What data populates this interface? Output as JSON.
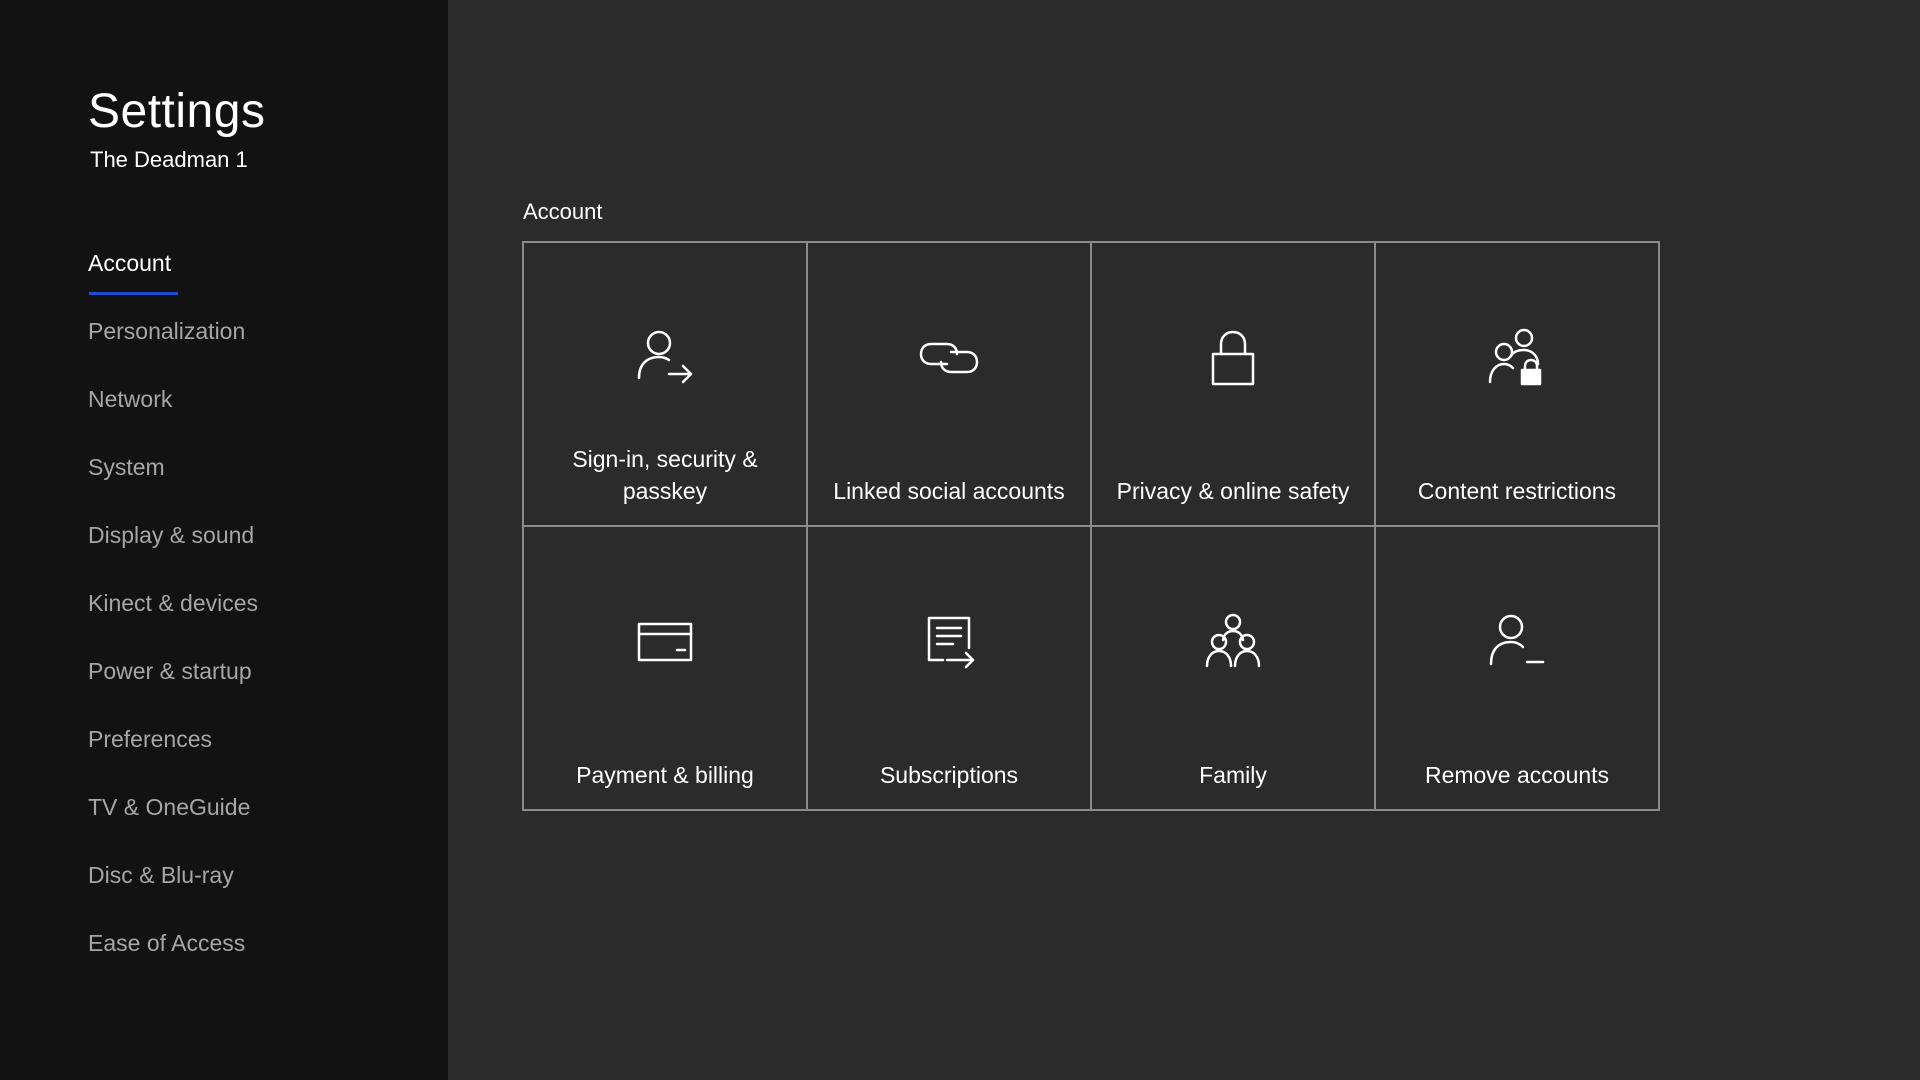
{
  "header": {
    "title": "Settings",
    "gamertag": "The Deadman 1"
  },
  "sidebar": {
    "items": [
      {
        "label": "Account",
        "active": true
      },
      {
        "label": "Personalization"
      },
      {
        "label": "Network"
      },
      {
        "label": "System"
      },
      {
        "label": "Display & sound"
      },
      {
        "label": "Kinect & devices"
      },
      {
        "label": "Power & startup"
      },
      {
        "label": "Preferences"
      },
      {
        "label": "TV & OneGuide"
      },
      {
        "label": "Disc & Blu-ray"
      },
      {
        "label": "Ease of Access"
      }
    ]
  },
  "main": {
    "section_title": "Account",
    "tiles": [
      {
        "label": "Sign-in, security & passkey",
        "icon": "person-arrow-icon"
      },
      {
        "label": "Linked social accounts",
        "icon": "link-icon"
      },
      {
        "label": "Privacy & online safety",
        "icon": "lock-icon"
      },
      {
        "label": "Content restrictions",
        "icon": "people-lock-icon"
      },
      {
        "label": "Payment & billing",
        "icon": "credit-card-icon"
      },
      {
        "label": "Subscriptions",
        "icon": "subscription-icon"
      },
      {
        "label": "Family",
        "icon": "family-icon"
      },
      {
        "label": "Remove accounts",
        "icon": "person-remove-icon"
      }
    ]
  },
  "colors": {
    "sidebar_bg": "#121212",
    "main_bg": "#2b2b2b",
    "accent": "#1e4cd6",
    "inactive_text": "#a6a6a6",
    "tile_border": "#8a8a8a"
  }
}
